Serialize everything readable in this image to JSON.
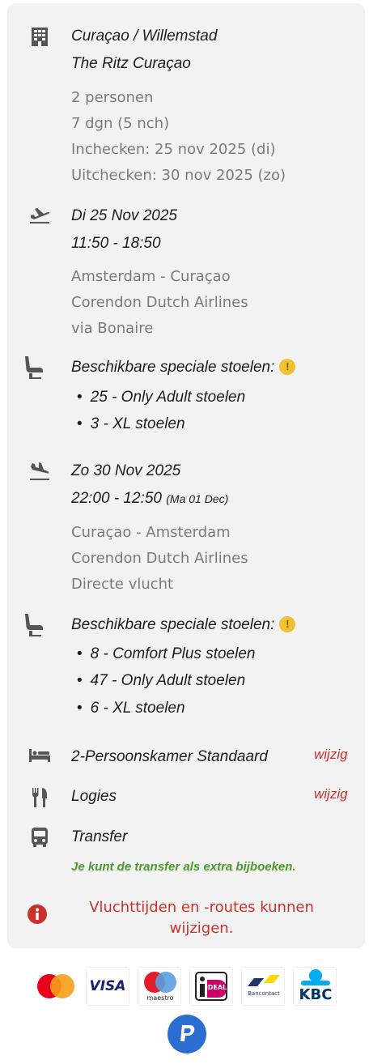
{
  "hotel": {
    "location": "Curaçao / Willemstad",
    "name": "The Ritz Curaçao",
    "persons": "2 personen",
    "duration": "7 dgn (5 nch)",
    "checkin": "Inchecken: 25 nov 2025 (di)",
    "checkout": "Uitchecken: 30 nov 2025 (zo)"
  },
  "outbound": {
    "date": "Di 25 Nov 2025",
    "time": "11:50 - 18:50",
    "route": "Amsterdam - Curaçao",
    "airline": "Corendon Dutch Airlines",
    "via": "via Bonaire",
    "seats_title": "Beschikbare speciale stoelen:",
    "seats": [
      "25 - Only Adult stoelen",
      "3 - XL stoelen"
    ]
  },
  "return": {
    "date": "Zo 30 Nov 2025",
    "time": "22:00 - 12:50",
    "arrival_day": "(Ma 01 Dec)",
    "route": "Curaçao - Amsterdam",
    "airline": "Corendon Dutch Airlines",
    "via": "Directe vlucht",
    "seats_title": "Beschikbare speciale stoelen:",
    "seats": [
      "8 - Comfort Plus stoelen",
      "47 - Only Adult stoelen",
      "6 - XL stoelen"
    ]
  },
  "room": {
    "label": "2-Persoonskamer Standaard",
    "edit": "wijzig"
  },
  "board": {
    "label": "Logies",
    "edit": "wijzig"
  },
  "transfer": {
    "label": "Transfer",
    "note": "Je kunt de transfer als extra bijboeken."
  },
  "notice": "Vluchttijden en -routes kunnen wijzigen.",
  "warn_symbol": "!",
  "payments": {
    "visa": "VISA",
    "maestro": "maestro",
    "ideal": "iDEAL",
    "bancontact": "Bancontact",
    "kbc": "KBC"
  },
  "colors": {
    "accent_red": "#c8322a",
    "green": "#4a9a2a",
    "warning": "#f0c233"
  }
}
